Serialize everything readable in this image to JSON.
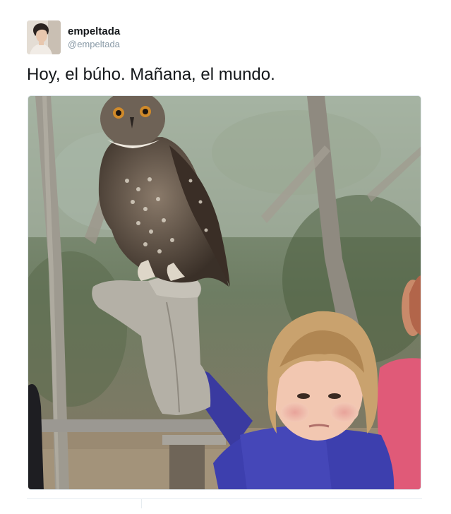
{
  "tweet": {
    "display_name": "empeltada",
    "handle": "@empeltada",
    "text": "Hoy, el búho. Mañana, el mundo.",
    "avatar": "avatar-photo",
    "media": "photo-girl-holding-owl"
  },
  "colors": {
    "name": "#14171a",
    "handle": "#8899a6",
    "divider": "#e6ecf0"
  }
}
